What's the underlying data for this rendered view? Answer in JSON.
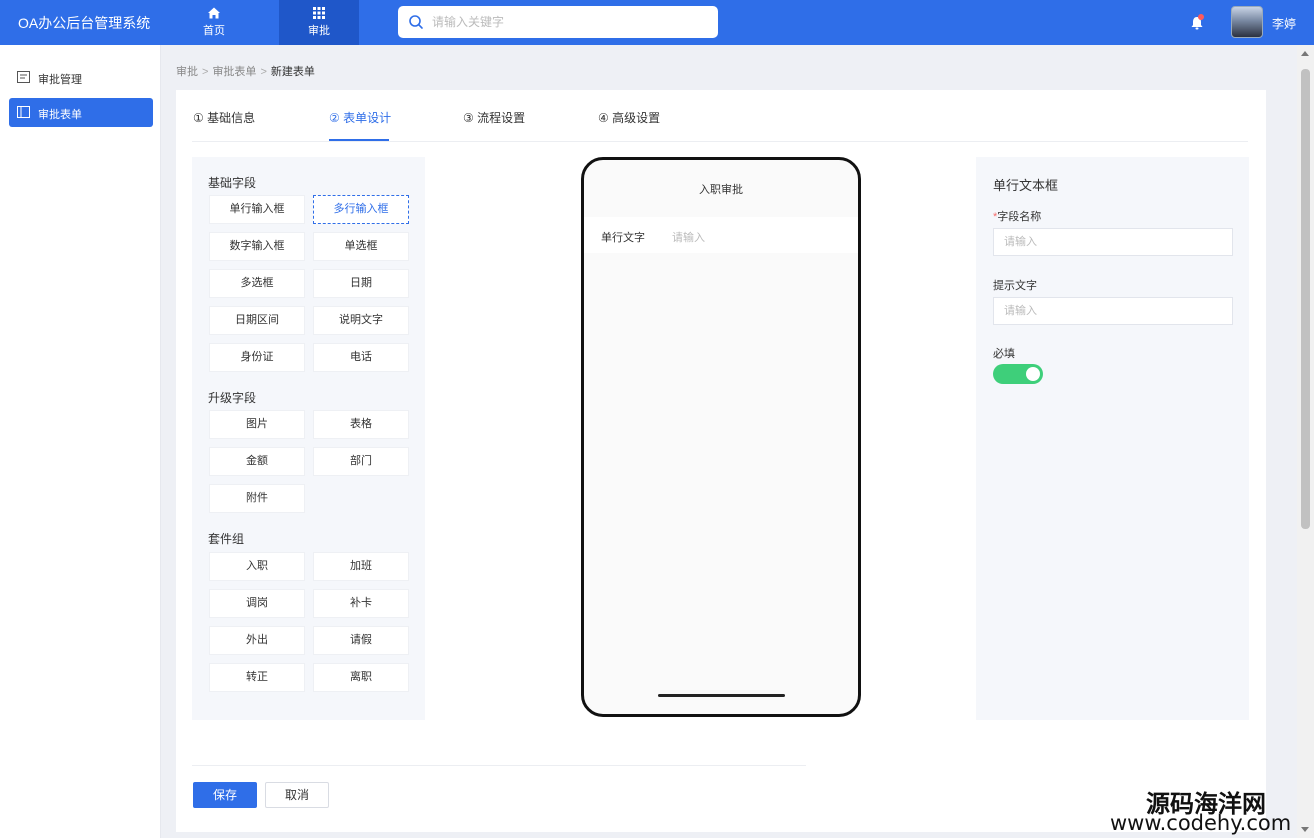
{
  "app": {
    "title": "OA办公后台管理系统"
  },
  "topnav": {
    "items": [
      {
        "label": "首页",
        "icon": "home-icon"
      },
      {
        "label": "审批",
        "icon": "grid-icon"
      }
    ],
    "active": "审批"
  },
  "search": {
    "placeholder": "请输入关键字",
    "value": ""
  },
  "user": {
    "name": "李婷",
    "notification_icon": "bell-icon"
  },
  "sidebar": {
    "items": [
      {
        "label": "审批管理",
        "icon": "approval-manage-icon"
      },
      {
        "label": "审批表单",
        "icon": "form-icon",
        "active": true
      }
    ]
  },
  "breadcrumb": [
    "审批",
    "审批表单",
    "新建表单"
  ],
  "steps": [
    {
      "label": "① 基础信息"
    },
    {
      "label": "② 表单设计",
      "active": true
    },
    {
      "label": "③ 流程设置"
    },
    {
      "label": "④ 高级设置"
    }
  ],
  "palette": {
    "groups": [
      {
        "title": "基础字段",
        "fields": [
          "单行输入框",
          "多行输入框",
          "数字输入框",
          "单选框",
          "多选框",
          "日期",
          "日期区间",
          "说明文字",
          "身份证",
          "电话"
        ]
      },
      {
        "title": "升级字段",
        "fields": [
          "图片",
          "表格",
          "金额",
          "部门",
          "附件"
        ]
      },
      {
        "title": "套件组",
        "fields": [
          "入职",
          "加班",
          "调岗",
          "补卡",
          "外出",
          "请假",
          "转正",
          "离职"
        ]
      }
    ],
    "selected": "多行输入框"
  },
  "preview": {
    "title": "入职审批",
    "field": {
      "label": "单行文字",
      "placeholder": "请输入"
    }
  },
  "properties": {
    "title": "单行文本框",
    "field_name": {
      "label": "字段名称",
      "required_mark": "*",
      "placeholder": "请输入"
    },
    "hint_text": {
      "label": "提示文字",
      "placeholder": "请输入"
    },
    "required": {
      "label": "必填",
      "on": true
    },
    "colors": {
      "toggle_on": "#3ecf7a"
    }
  },
  "actions": {
    "save": "保存",
    "cancel": "取消"
  },
  "theme": {
    "primary": "#2f6ee8",
    "header_active": "#1f57c9"
  },
  "watermark": {
    "cn": "源码海洋网",
    "en": "www.codehy.com"
  }
}
